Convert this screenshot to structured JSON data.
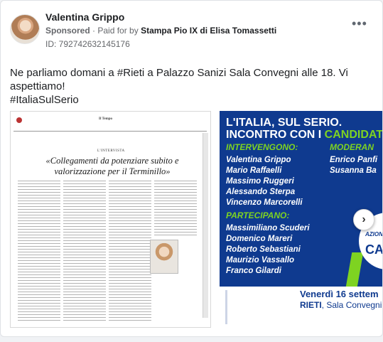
{
  "advertiser": {
    "name": "Valentina Grippo",
    "sponsored": "Sponsored",
    "separator": "·",
    "paid_for_label": "Paid for by",
    "paid_for": "Stampa Pio IX di Elisa Tomassetti",
    "ad_id": "ID: 792742632145176"
  },
  "post": {
    "line1": "Ne parliamo domani a #Rieti a Palazzo Sanizi Sala Convegni alle 18. Vi aspettiamo!",
    "line2": "#ItaliaSulSerio"
  },
  "slides": {
    "newspaper": {
      "masthead": "Il Tempo",
      "section": "L'INTERVISTA",
      "headline": "«Collegamenti da potenziare subito e valorizzazione per il Terminillo»"
    },
    "poster": {
      "title_line1": "L'ITALIA, SUL SERIO.",
      "title_line2_prefix": "INCONTRO CON I ",
      "title_line2_highlight": "CANDIDATI",
      "intervengono_label": "INTERVENGONO:",
      "intervengono": [
        "Valentina Grippo",
        "Mario Raffaelli",
        "Massimo Ruggeri",
        "Alessando Sterpa",
        "Vincenzo Marcorelli"
      ],
      "moderano_label": "MODERAN",
      "moderano": [
        "Enrico Panfi",
        "Susanna Ba"
      ],
      "partecipano_label": "PARTECIPANO:",
      "partecipano": [
        "Massimiliano Scuderi",
        "Domenico Mareri",
        "Roberto Sebastiani",
        "Maurizio Vassallo",
        "Franco Gilardi"
      ],
      "logo_small": "AZION",
      "logo_big": "CAL",
      "date": "Venerdì 16 settem",
      "place_city": "RIETI",
      "place_rest": ", Sala Convegni Pa"
    }
  },
  "carousel": {
    "next_icon": "chevron-right-icon",
    "next_glyph": "›"
  },
  "colors": {
    "poster_blue": "#0f3a8f",
    "poster_green": "#7ed321",
    "text": "#1c1e21",
    "muted": "#65676b"
  }
}
